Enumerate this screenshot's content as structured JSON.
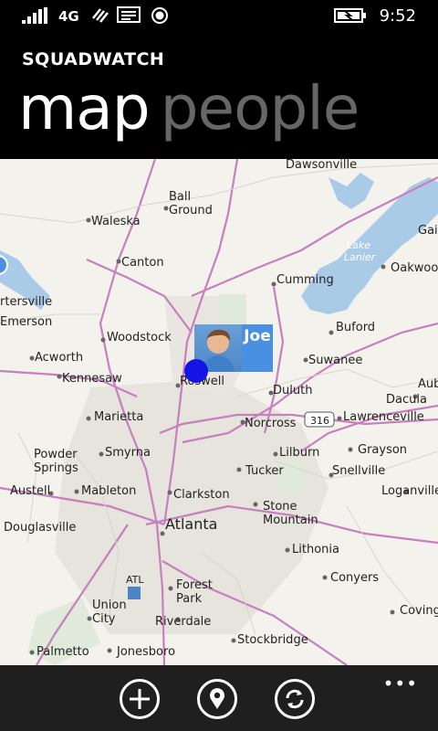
{
  "status": {
    "network": "4G",
    "time": "9:52"
  },
  "app": {
    "title": "SQUADWATCH"
  },
  "pivot": {
    "active": "map",
    "inactive": "people"
  },
  "marker": {
    "name": "Joe"
  },
  "map": {
    "cities": {
      "dawsonville": "Dawsonville",
      "ball": "Ball",
      "ground": "Ground",
      "waleska": "Waleska",
      "gai": "Gai",
      "lake": "Lake",
      "lanier": "Lanier",
      "canton": "Canton",
      "cumming": "Cumming",
      "oakwood": "Oakwoo",
      "rtersville": "rtersville",
      "emerson": "Emerson",
      "woodstock": "Woodstock",
      "buford": "Buford",
      "acworth": "Acworth",
      "suwanee": "Suwanee",
      "kennesaw": "Kennesaw",
      "roswell": "Roswell",
      "duluth": "Duluth",
      "aub": "Aub",
      "dacula": "Dacula",
      "marietta": "Marietta",
      "norcross": "Norcross",
      "hwy": "316",
      "lawrenceville": "Lawrenceville",
      "powder": "Powder",
      "springs": "Springs",
      "smyrna": "Smyrna",
      "lilburn": "Lilburn",
      "grayson": "Grayson",
      "tucker": "Tucker",
      "snellville": "Snellville",
      "austell": "Austell",
      "mableton": "Mableton",
      "clarkston": "Clarkston",
      "loganville": "Loganville",
      "stone": "Stone",
      "mountain": "Mountain",
      "douglasville": "Douglasville",
      "atlanta": "Atlanta",
      "lithonia": "Lithonia",
      "conyers": "Conyers",
      "atl": "ATL",
      "forest": "Forest",
      "park": "Park",
      "union": "Union",
      "city": "City",
      "coving": "Coving",
      "riverdale": "Riverdale",
      "stockbridge": "Stockbridge",
      "palmetto": "Palmetto",
      "jonesboro": "Jonesboro"
    }
  },
  "appbar": {
    "more": "•••",
    "buttons": [
      "add-icon",
      "location-pin-icon",
      "sync-icon"
    ]
  }
}
